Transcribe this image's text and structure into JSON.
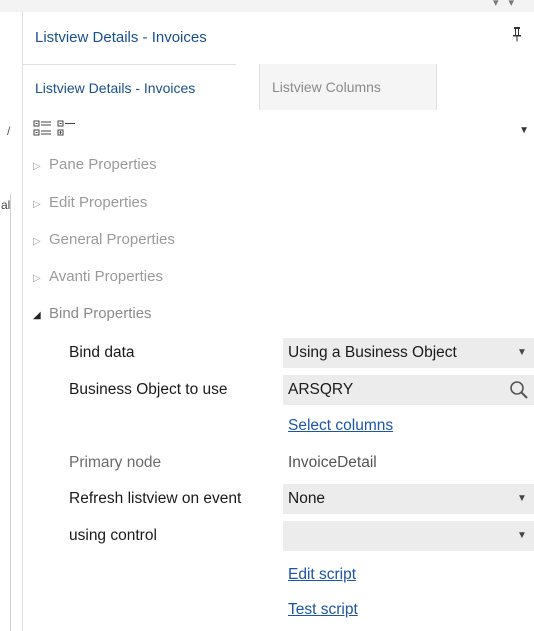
{
  "panel": {
    "title": "Listview Details - Invoices",
    "pin_icon": "pin-icon"
  },
  "tabs": [
    {
      "label": "Listview Details - Invoices",
      "active": true
    },
    {
      "label": "Listview Columns",
      "active": false
    }
  ],
  "toolbar": {
    "icons": [
      "categorized-view-icon",
      "alphabetical-view-icon"
    ],
    "dropdown_icon": "dropdown-caret-icon"
  },
  "edge_fragments": [
    "/",
    "al"
  ],
  "categories": [
    {
      "label": "Pane Properties",
      "expanded": false
    },
    {
      "label": "Edit Properties",
      "expanded": false
    },
    {
      "label": "General Properties",
      "expanded": false
    },
    {
      "label": "Avanti Properties",
      "expanded": false
    },
    {
      "label": "Bind Properties",
      "expanded": true
    }
  ],
  "bind": {
    "bind_data": {
      "label": "Bind data",
      "value": "Using a Business Object"
    },
    "business_object": {
      "label": "Business Object to use",
      "value": "ARSQRY"
    },
    "select_columns": "Select columns",
    "primary_node": {
      "label": "Primary node",
      "value": "InvoiceDetail"
    },
    "refresh": {
      "label": "Refresh listview on event",
      "value": "None"
    },
    "using_control": {
      "label": "using control",
      "value": ""
    },
    "edit_script": "Edit script",
    "test_script": "Test script"
  },
  "colors": {
    "accent": "#1a4f8f",
    "link": "#1a56a6",
    "field_bg": "#ececec",
    "category_text": "#9a9a9a"
  }
}
